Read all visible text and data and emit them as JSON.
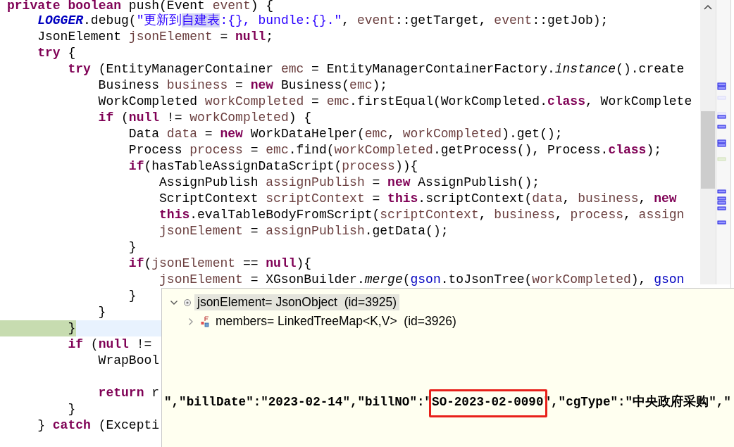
{
  "code_lines": [
    {
      "kind": "code",
      "current": false,
      "tokens": [
        {
          "kind": "keyword",
          "text": "private "
        },
        {
          "kind": "keyword",
          "text": "boolean"
        },
        {
          "kind": "plain",
          "text": " push(Event "
        },
        {
          "kind": "local",
          "text": "event"
        },
        {
          "kind": "plain",
          "text": ") {"
        }
      ]
    },
    {
      "kind": "code",
      "current": false,
      "tokens": [
        {
          "kind": "static-field",
          "text": "    LOGGER"
        },
        {
          "kind": "plain",
          "text": ".debug("
        },
        {
          "kind": "string",
          "text": "\"更新到"
        },
        {
          "kind": "match",
          "text": "自建表"
        },
        {
          "kind": "string",
          "text": ":{}, bundle:{}.\""
        },
        {
          "kind": "plain",
          "text": ", "
        },
        {
          "kind": "local",
          "text": "event"
        },
        {
          "kind": "plain",
          "text": "::getTarget, "
        },
        {
          "kind": "local",
          "text": "event"
        },
        {
          "kind": "plain",
          "text": "::getJob);"
        }
      ]
    },
    {
      "kind": "code",
      "current": false,
      "tokens": [
        {
          "kind": "plain",
          "text": "    JsonElement "
        },
        {
          "kind": "local",
          "text": "jsonElement"
        },
        {
          "kind": "plain",
          "text": " = "
        },
        {
          "kind": "keyword",
          "text": "null"
        },
        {
          "kind": "plain",
          "text": ";"
        }
      ]
    },
    {
      "kind": "code",
      "current": false,
      "tokens": [
        {
          "kind": "keyword",
          "text": "    try"
        },
        {
          "kind": "plain",
          "text": " {"
        }
      ]
    },
    {
      "kind": "code",
      "current": false,
      "tokens": [
        {
          "kind": "keyword",
          "text": "        try"
        },
        {
          "kind": "plain",
          "text": " (EntityManagerContainer "
        },
        {
          "kind": "local",
          "text": "emc"
        },
        {
          "kind": "plain",
          "text": " = EntityManagerContainerFactory."
        },
        {
          "kind": "static-method",
          "text": "instance"
        },
        {
          "kind": "plain",
          "text": "().create"
        }
      ]
    },
    {
      "kind": "code",
      "current": false,
      "tokens": [
        {
          "kind": "plain",
          "text": "            Business "
        },
        {
          "kind": "local",
          "text": "business"
        },
        {
          "kind": "plain",
          "text": " = "
        },
        {
          "kind": "keyword",
          "text": "new"
        },
        {
          "kind": "plain",
          "text": " Business("
        },
        {
          "kind": "local",
          "text": "emc"
        },
        {
          "kind": "plain",
          "text": ");"
        }
      ]
    },
    {
      "kind": "code",
      "current": false,
      "tokens": [
        {
          "kind": "plain",
          "text": "            WorkCompleted "
        },
        {
          "kind": "local",
          "text": "workCompleted"
        },
        {
          "kind": "plain",
          "text": " = "
        },
        {
          "kind": "local",
          "text": "emc"
        },
        {
          "kind": "plain",
          "text": ".firstEqual(WorkCompleted."
        },
        {
          "kind": "keyword",
          "text": "class"
        },
        {
          "kind": "plain",
          "text": ", WorkComplete"
        }
      ]
    },
    {
      "kind": "code",
      "current": false,
      "tokens": [
        {
          "kind": "keyword",
          "text": "            if"
        },
        {
          "kind": "plain",
          "text": " ("
        },
        {
          "kind": "keyword",
          "text": "null"
        },
        {
          "kind": "plain",
          "text": " != "
        },
        {
          "kind": "local",
          "text": "workCompleted"
        },
        {
          "kind": "plain",
          "text": ") {"
        }
      ]
    },
    {
      "kind": "code",
      "current": false,
      "tokens": [
        {
          "kind": "plain",
          "text": "                Data "
        },
        {
          "kind": "local",
          "text": "data"
        },
        {
          "kind": "plain",
          "text": " = "
        },
        {
          "kind": "keyword",
          "text": "new"
        },
        {
          "kind": "plain",
          "text": " WorkDataHelper("
        },
        {
          "kind": "local",
          "text": "emc"
        },
        {
          "kind": "plain",
          "text": ", "
        },
        {
          "kind": "local",
          "text": "workCompleted"
        },
        {
          "kind": "plain",
          "text": ").get();"
        }
      ]
    },
    {
      "kind": "code",
      "current": false,
      "tokens": [
        {
          "kind": "plain",
          "text": "                Process "
        },
        {
          "kind": "local",
          "text": "process"
        },
        {
          "kind": "plain",
          "text": " = "
        },
        {
          "kind": "local",
          "text": "emc"
        },
        {
          "kind": "plain",
          "text": ".find("
        },
        {
          "kind": "local",
          "text": "workCompleted"
        },
        {
          "kind": "plain",
          "text": ".getProcess(), Process."
        },
        {
          "kind": "keyword",
          "text": "class"
        },
        {
          "kind": "plain",
          "text": ");"
        }
      ]
    },
    {
      "kind": "code",
      "current": false,
      "tokens": [
        {
          "kind": "keyword",
          "text": "                if"
        },
        {
          "kind": "plain",
          "text": "(hasTableAssignDataScript("
        },
        {
          "kind": "local",
          "text": "process"
        },
        {
          "kind": "plain",
          "text": ")){"
        }
      ]
    },
    {
      "kind": "code",
      "current": false,
      "tokens": [
        {
          "kind": "plain",
          "text": "                    AssignPublish "
        },
        {
          "kind": "local",
          "text": "assignPublish"
        },
        {
          "kind": "plain",
          "text": " = "
        },
        {
          "kind": "keyword",
          "text": "new"
        },
        {
          "kind": "plain",
          "text": " AssignPublish();"
        }
      ]
    },
    {
      "kind": "code",
      "current": false,
      "tokens": [
        {
          "kind": "plain",
          "text": "                    ScriptContext "
        },
        {
          "kind": "local",
          "text": "scriptContext"
        },
        {
          "kind": "plain",
          "text": " = "
        },
        {
          "kind": "keyword",
          "text": "this"
        },
        {
          "kind": "plain",
          "text": ".scriptContext("
        },
        {
          "kind": "local",
          "text": "data"
        },
        {
          "kind": "plain",
          "text": ", "
        },
        {
          "kind": "local",
          "text": "business"
        },
        {
          "kind": "plain",
          "text": ", "
        },
        {
          "kind": "keyword",
          "text": "new"
        }
      ]
    },
    {
      "kind": "code",
      "current": false,
      "tokens": [
        {
          "kind": "keyword",
          "text": "                    this"
        },
        {
          "kind": "plain",
          "text": ".evalTableBodyFromScript("
        },
        {
          "kind": "local",
          "text": "scriptContext"
        },
        {
          "kind": "plain",
          "text": ", "
        },
        {
          "kind": "local",
          "text": "business"
        },
        {
          "kind": "plain",
          "text": ", "
        },
        {
          "kind": "local",
          "text": "process"
        },
        {
          "kind": "plain",
          "text": ", "
        },
        {
          "kind": "local",
          "text": "assign"
        }
      ]
    },
    {
      "kind": "code",
      "current": false,
      "tokens": [
        {
          "kind": "local",
          "text": "                    jsonElement"
        },
        {
          "kind": "plain",
          "text": " = "
        },
        {
          "kind": "local",
          "text": "assignPublish"
        },
        {
          "kind": "plain",
          "text": ".getData();"
        }
      ]
    },
    {
      "kind": "code",
      "current": false,
      "tokens": [
        {
          "kind": "plain",
          "text": "                }"
        }
      ]
    },
    {
      "kind": "code",
      "current": false,
      "tokens": [
        {
          "kind": "keyword",
          "text": "                if"
        },
        {
          "kind": "plain",
          "text": "("
        },
        {
          "kind": "local",
          "text": "jsonElement"
        },
        {
          "kind": "plain",
          "text": " == "
        },
        {
          "kind": "keyword",
          "text": "null"
        },
        {
          "kind": "plain",
          "text": "){"
        }
      ]
    },
    {
      "kind": "code",
      "current": false,
      "tokens": [
        {
          "kind": "local",
          "text": "                    jsonElement"
        },
        {
          "kind": "plain",
          "text": " = XGsonBuilder."
        },
        {
          "kind": "static-method",
          "text": "merge"
        },
        {
          "kind": "plain",
          "text": "("
        },
        {
          "kind": "field",
          "text": "gson"
        },
        {
          "kind": "plain",
          "text": ".toJsonTree("
        },
        {
          "kind": "local",
          "text": "workCompleted"
        },
        {
          "kind": "plain",
          "text": "), "
        },
        {
          "kind": "field",
          "text": "gson"
        }
      ]
    },
    {
      "kind": "code",
      "current": false,
      "tokens": [
        {
          "kind": "plain",
          "text": "                }"
        }
      ]
    },
    {
      "kind": "code",
      "current": false,
      "tokens": [
        {
          "kind": "plain",
          "text": "            }"
        }
      ]
    },
    {
      "kind": "code",
      "current": true,
      "tokens": [
        {
          "kind": "plain",
          "text": "        }"
        }
      ]
    },
    {
      "kind": "code",
      "current": false,
      "tokens": [
        {
          "kind": "keyword",
          "text": "        if"
        },
        {
          "kind": "plain",
          "text": " ("
        },
        {
          "kind": "keyword",
          "text": "null"
        },
        {
          "kind": "plain",
          "text": " !="
        }
      ]
    },
    {
      "kind": "code",
      "current": false,
      "tokens": [
        {
          "kind": "plain",
          "text": "            WrapBool"
        }
      ]
    },
    {
      "kind": "blank"
    },
    {
      "kind": "code",
      "current": false,
      "tokens": [
        {
          "kind": "keyword",
          "text": "            return"
        },
        {
          "kind": "plain",
          "text": " r"
        }
      ]
    },
    {
      "kind": "code",
      "current": false,
      "tokens": [
        {
          "kind": "plain",
          "text": "        }"
        }
      ]
    },
    {
      "kind": "code",
      "current": false,
      "tokens": [
        {
          "kind": "plain",
          "text": "    } "
        },
        {
          "kind": "keyword",
          "text": "catch"
        },
        {
          "kind": "plain",
          "text": " (Excepti"
        }
      ]
    }
  ],
  "inspect_popup": {
    "tree": [
      {
        "kind": "object",
        "label": "jsonElement= JsonObject  (id=3925)",
        "selected": true,
        "expanded": true,
        "children": [
          {
            "kind": "field",
            "label": "members= LinkedTreeMap<K,V>  (id=3926)",
            "selected": false,
            "expanded": false
          }
        ]
      }
    ],
    "detail": [
      {
        "text": "\",\"billDate\":\"2023-02-14\",\"billNO\":\"",
        "marked": false
      },
      {
        "text": "SO-2023-02-0090",
        "marked": true
      },
      {
        "text": "\",\"cgType\":\"中央政府采购\",\"",
        "marked": false
      }
    ]
  }
}
